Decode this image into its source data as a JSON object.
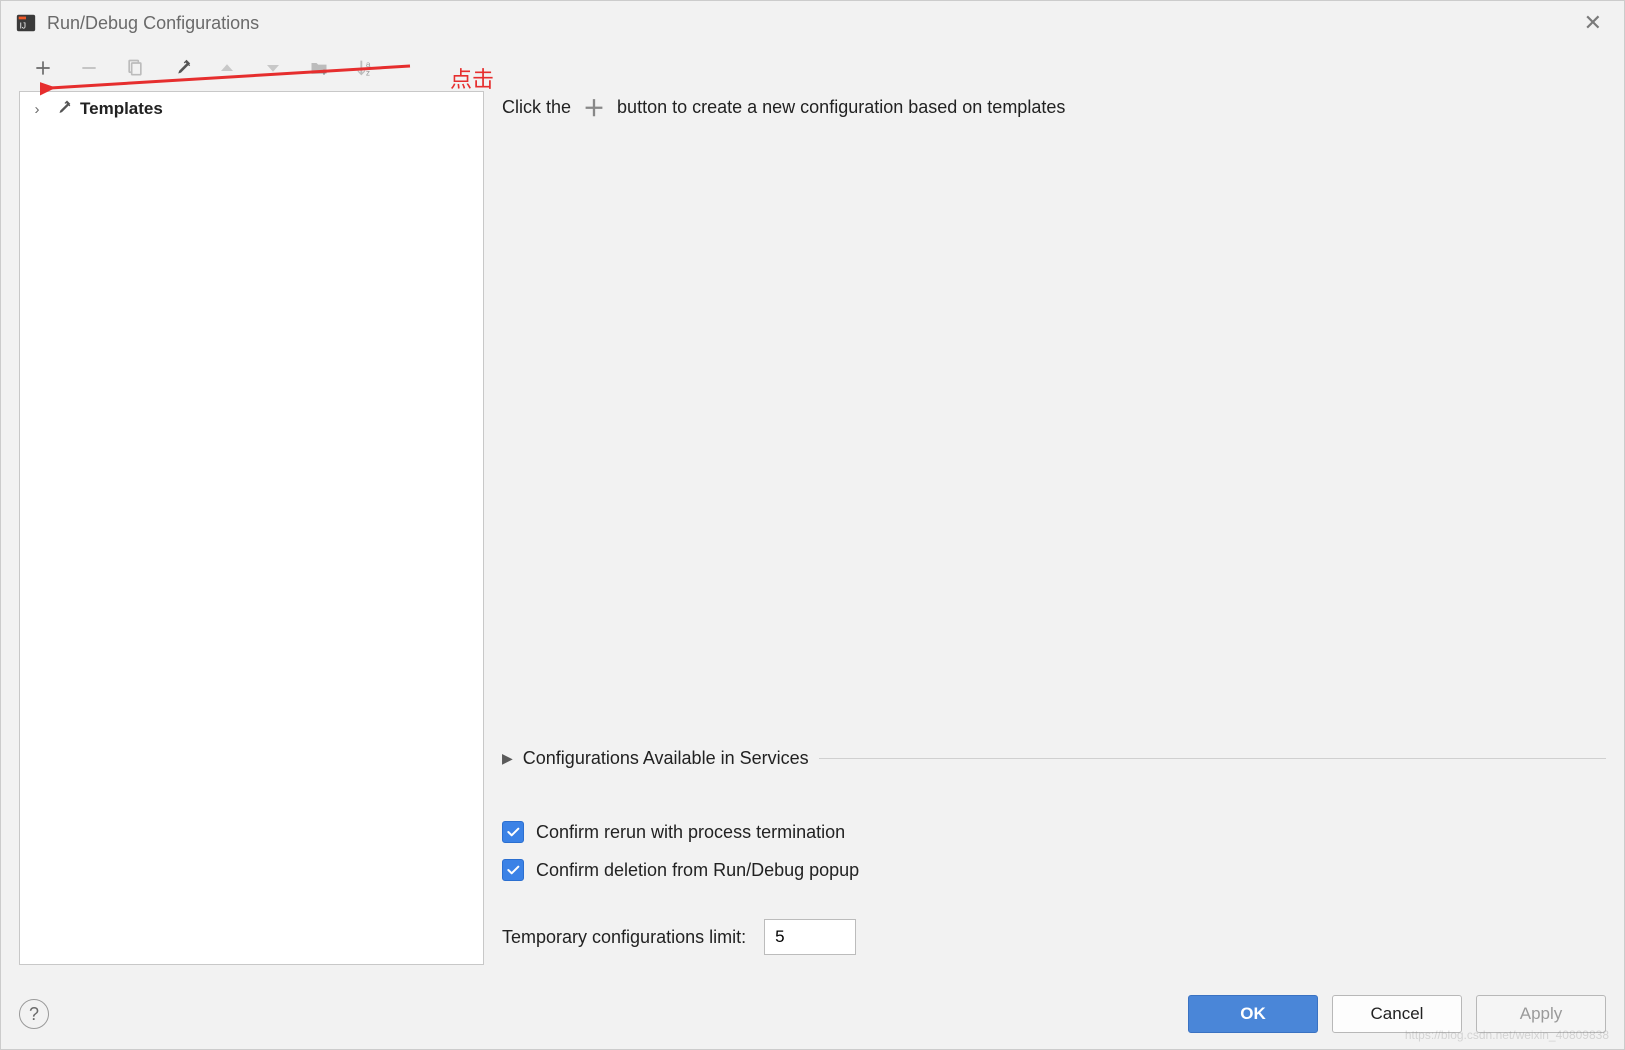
{
  "titlebar": {
    "title": "Run/Debug Configurations"
  },
  "toolbar": {
    "icons": {
      "add": "add-icon",
      "remove": "remove-icon",
      "copy": "copy-icon",
      "edit": "wrench-icon",
      "up": "triangle-up-icon",
      "down": "triangle-down-icon",
      "folder": "folder-add-icon",
      "sort": "sort-az-icon"
    }
  },
  "tree": {
    "templates_label": "Templates"
  },
  "hint": {
    "before": "Click the",
    "after": "button to create a new configuration based on templates"
  },
  "section": {
    "services_label": "Configurations Available in Services"
  },
  "checks": {
    "confirm_rerun": "Confirm rerun with process termination",
    "confirm_delete": "Confirm deletion from Run/Debug popup"
  },
  "limit": {
    "label": "Temporary configurations limit:",
    "value": "5"
  },
  "buttons": {
    "ok": "OK",
    "cancel": "Cancel",
    "apply": "Apply",
    "help": "?"
  },
  "annotation": {
    "text": "点击"
  },
  "watermark": "https://blog.csdn.net/weixin_40809838"
}
